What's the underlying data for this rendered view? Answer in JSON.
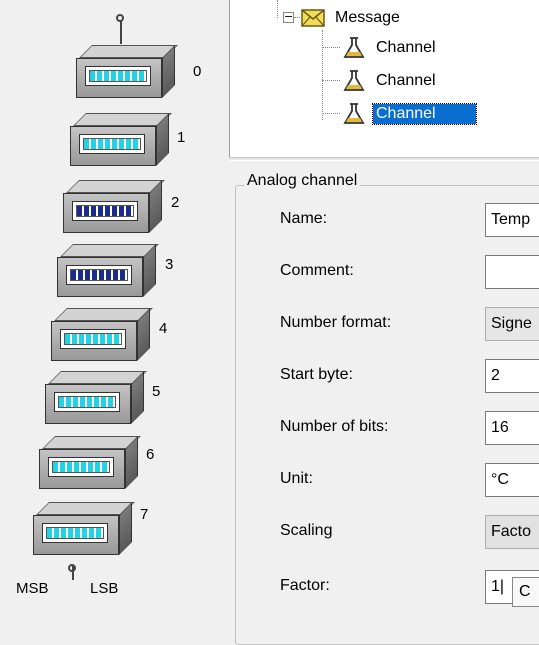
{
  "stack": {
    "bytes": [
      {
        "index": "0",
        "bit_color": "#22d3e6"
      },
      {
        "index": "1",
        "bit_color": "#22d3e6"
      },
      {
        "index": "2",
        "bit_color": "#1c2c8c"
      },
      {
        "index": "3",
        "bit_color": "#1c2c8c"
      },
      {
        "index": "4",
        "bit_color": "#22d3e6"
      },
      {
        "index": "5",
        "bit_color": "#22d3e6"
      },
      {
        "index": "6",
        "bit_color": "#22d3e6"
      },
      {
        "index": "7",
        "bit_color": "#22d3e6"
      }
    ],
    "msb_label": "MSB",
    "lsb_label": "LSB"
  },
  "tree": {
    "message_label": "Message",
    "message_icon": "envelope-icon",
    "channels": [
      {
        "label": "Channel",
        "icon": "flask-icon",
        "selected": false
      },
      {
        "label": "Channel",
        "icon": "flask-icon",
        "selected": false
      },
      {
        "label": "Channel",
        "icon": "flask-icon",
        "selected": true
      }
    ],
    "collapse_symbol": "−"
  },
  "group": {
    "title": "Analog channel",
    "fields": {
      "name": {
        "label": "Name:",
        "value": "Temp"
      },
      "comment": {
        "label": "Comment:",
        "value": ""
      },
      "number_format": {
        "label": "Number format:",
        "value": "Signe"
      },
      "start_byte": {
        "label": "Start byte:",
        "value": "2"
      },
      "number_of_bits": {
        "label": "Number of bits:",
        "value": "16"
      },
      "unit": {
        "label": "Unit:",
        "value": "°C"
      },
      "scaling": {
        "label": "Scaling",
        "value": "Facto"
      },
      "factor": {
        "label": "Factor:",
        "value": "1|"
      }
    },
    "factor_popup_text": "C"
  },
  "colors": {
    "selection": "#0a6ed1",
    "bits_light": "#22d3e6",
    "bits_dark": "#1c2c8c"
  }
}
